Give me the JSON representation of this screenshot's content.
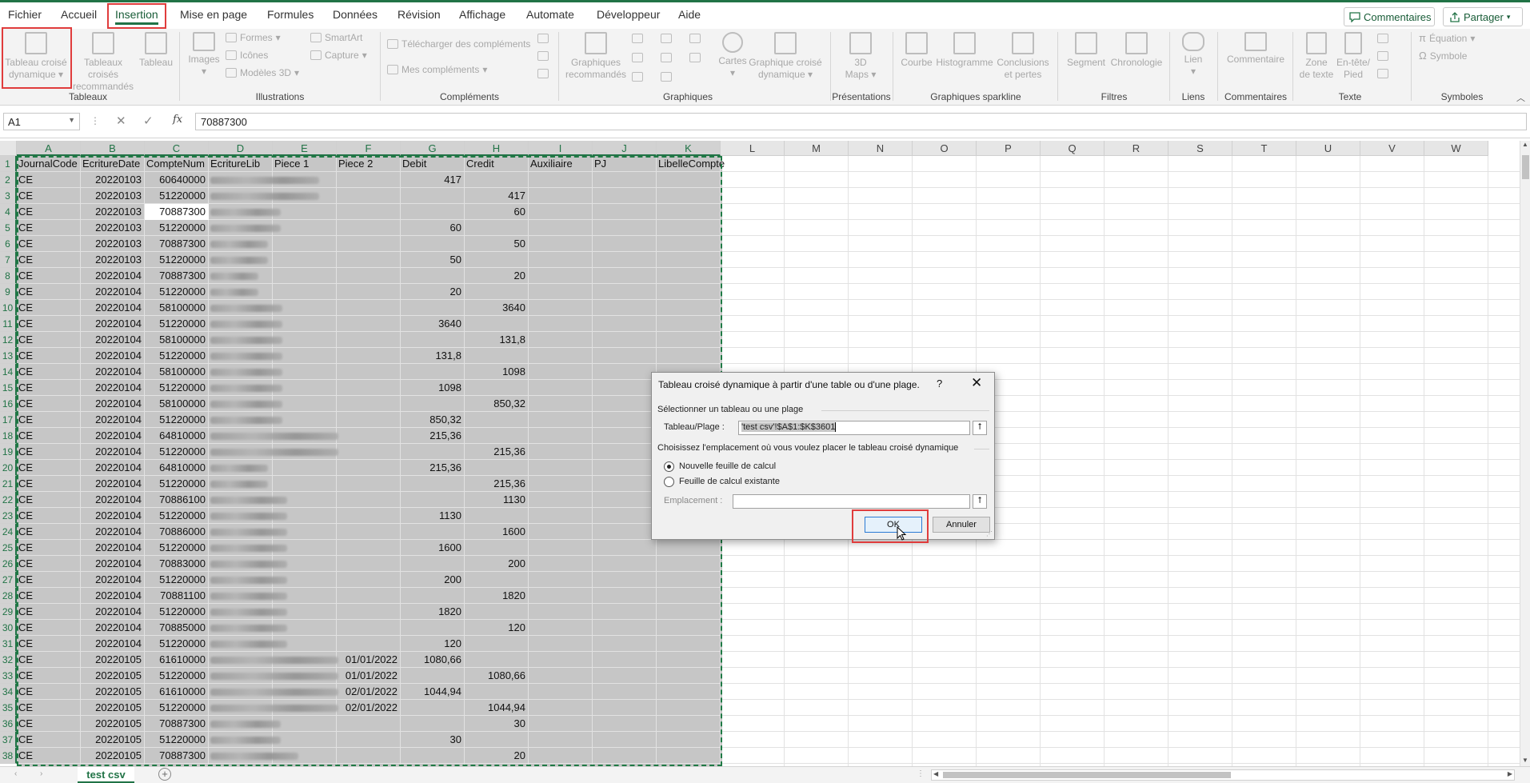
{
  "menu": {
    "tabs": [
      "Fichier",
      "Accueil",
      "Insertion",
      "Mise en page",
      "Formules",
      "Données",
      "Révision",
      "Affichage",
      "Automate",
      "Développeur",
      "Aide"
    ],
    "active_tab": "Insertion",
    "comments_label": "Commentaires",
    "share_label": "Partager"
  },
  "ribbon": {
    "tableaux": {
      "group": "Tableaux",
      "pivot": [
        "Tableau croisé",
        "dynamique"
      ],
      "recommended": [
        "Tableaux croisés",
        "recommandés"
      ],
      "table": "Tableau"
    },
    "illustrations": {
      "group": "Illustrations",
      "images": "Images",
      "forms": "Formes",
      "icons": "Icônes",
      "models3d": "Modèles 3D",
      "smartart": "SmartArt",
      "capture": "Capture"
    },
    "complements": {
      "group": "Compléments",
      "download": "Télécharger des compléments",
      "mine": "Mes compléments"
    },
    "graphiques": {
      "group": "Graphiques",
      "recommended": [
        "Graphiques",
        "recommandés"
      ],
      "maps": "Cartes",
      "pivotchart": [
        "Graphique croisé",
        "dynamique"
      ]
    },
    "presentations": {
      "group": "Présentations",
      "maps3d": [
        "3D",
        "Maps"
      ]
    },
    "sparkline": {
      "group": "Graphiques sparkline",
      "line": "Courbe",
      "histogram": "Histogramme",
      "winloss": [
        "Conclusions",
        "et pertes"
      ]
    },
    "filtres": {
      "group": "Filtres",
      "slicer": "Segment",
      "timeline": "Chronologie"
    },
    "liens": {
      "group": "Liens",
      "link": "Lien"
    },
    "commentaires": {
      "group": "Commentaires",
      "comment": "Commentaire"
    },
    "texte": {
      "group": "Texte",
      "textbox": [
        "Zone",
        "de texte"
      ],
      "header": [
        "En-tête/",
        "Pied"
      ]
    },
    "symboles": {
      "group": "Symboles",
      "equation": "Équation",
      "symbol": "Symbole"
    }
  },
  "formula_bar": {
    "name_box": "A1",
    "fx": "fx",
    "content": "70887300"
  },
  "columns": [
    "A",
    "B",
    "C",
    "D",
    "E",
    "F",
    "G",
    "H",
    "I",
    "J",
    "K",
    "L",
    "M",
    "N",
    "O",
    "P",
    "Q",
    "R",
    "S",
    "T",
    "U",
    "V",
    "W"
  ],
  "header_row": [
    "JournalCode",
    "EcritureDate",
    "CompteNum",
    "EcritureLib",
    "Piece 1",
    "Piece 2",
    "Debit",
    "Credit",
    "Auxiliaire",
    "PJ",
    "LibelleCompte"
  ],
  "rows": [
    {
      "n": "2",
      "a": "CE",
      "b": "20220103",
      "c": "60640000",
      "f": "",
      "g": "417",
      "h": ""
    },
    {
      "n": "3",
      "a": "CE",
      "b": "20220103",
      "c": "51220000",
      "f": "",
      "g": "",
      "h": "417"
    },
    {
      "n": "4",
      "a": "CE",
      "b": "20220103",
      "c": "70887300",
      "f": "",
      "g": "",
      "h": "60"
    },
    {
      "n": "5",
      "a": "CE",
      "b": "20220103",
      "c": "51220000",
      "f": "",
      "g": "60",
      "h": ""
    },
    {
      "n": "6",
      "a": "CE",
      "b": "20220103",
      "c": "70887300",
      "f": "",
      "g": "",
      "h": "50"
    },
    {
      "n": "7",
      "a": "CE",
      "b": "20220103",
      "c": "51220000",
      "f": "",
      "g": "50",
      "h": ""
    },
    {
      "n": "8",
      "a": "CE",
      "b": "20220104",
      "c": "70887300",
      "f": "",
      "g": "",
      "h": "20"
    },
    {
      "n": "9",
      "a": "CE",
      "b": "20220104",
      "c": "51220000",
      "f": "",
      "g": "20",
      "h": ""
    },
    {
      "n": "10",
      "a": "CE",
      "b": "20220104",
      "c": "58100000",
      "f": "",
      "g": "",
      "h": "3640"
    },
    {
      "n": "11",
      "a": "CE",
      "b": "20220104",
      "c": "51220000",
      "f": "",
      "g": "3640",
      "h": ""
    },
    {
      "n": "12",
      "a": "CE",
      "b": "20220104",
      "c": "58100000",
      "f": "",
      "g": "",
      "h": "131,8"
    },
    {
      "n": "13",
      "a": "CE",
      "b": "20220104",
      "c": "51220000",
      "f": "",
      "g": "131,8",
      "h": ""
    },
    {
      "n": "14",
      "a": "CE",
      "b": "20220104",
      "c": "58100000",
      "f": "",
      "g": "",
      "h": "1098"
    },
    {
      "n": "15",
      "a": "CE",
      "b": "20220104",
      "c": "51220000",
      "f": "",
      "g": "1098",
      "h": ""
    },
    {
      "n": "16",
      "a": "CE",
      "b": "20220104",
      "c": "58100000",
      "f": "",
      "g": "",
      "h": "850,32"
    },
    {
      "n": "17",
      "a": "CE",
      "b": "20220104",
      "c": "51220000",
      "f": "",
      "g": "850,32",
      "h": ""
    },
    {
      "n": "18",
      "a": "CE",
      "b": "20220104",
      "c": "64810000",
      "f": "",
      "g": "215,36",
      "h": ""
    },
    {
      "n": "19",
      "a": "CE",
      "b": "20220104",
      "c": "51220000",
      "f": "",
      "g": "",
      "h": "215,36"
    },
    {
      "n": "20",
      "a": "CE",
      "b": "20220104",
      "c": "64810000",
      "f": "",
      "g": "215,36",
      "h": ""
    },
    {
      "n": "21",
      "a": "CE",
      "b": "20220104",
      "c": "51220000",
      "f": "",
      "g": "",
      "h": "215,36"
    },
    {
      "n": "22",
      "a": "CE",
      "b": "20220104",
      "c": "70886100",
      "f": "",
      "g": "",
      "h": "1130"
    },
    {
      "n": "23",
      "a": "CE",
      "b": "20220104",
      "c": "51220000",
      "f": "",
      "g": "1130",
      "h": ""
    },
    {
      "n": "24",
      "a": "CE",
      "b": "20220104",
      "c": "70886000",
      "f": "",
      "g": "",
      "h": "1600"
    },
    {
      "n": "25",
      "a": "CE",
      "b": "20220104",
      "c": "51220000",
      "f": "",
      "g": "1600",
      "h": ""
    },
    {
      "n": "26",
      "a": "CE",
      "b": "20220104",
      "c": "70883000",
      "f": "",
      "g": "",
      "h": "200"
    },
    {
      "n": "27",
      "a": "CE",
      "b": "20220104",
      "c": "51220000",
      "f": "",
      "g": "200",
      "h": ""
    },
    {
      "n": "28",
      "a": "CE",
      "b": "20220104",
      "c": "70881100",
      "f": "",
      "g": "",
      "h": "1820"
    },
    {
      "n": "29",
      "a": "CE",
      "b": "20220104",
      "c": "51220000",
      "f": "",
      "g": "1820",
      "h": ""
    },
    {
      "n": "30",
      "a": "CE",
      "b": "20220104",
      "c": "70885000",
      "f": "",
      "g": "",
      "h": "120"
    },
    {
      "n": "31",
      "a": "CE",
      "b": "20220104",
      "c": "51220000",
      "f": "",
      "g": "120",
      "h": ""
    },
    {
      "n": "32",
      "a": "CE",
      "b": "20220105",
      "c": "61610000",
      "f": "01/01/2022",
      "g": "1080,66",
      "h": ""
    },
    {
      "n": "33",
      "a": "CE",
      "b": "20220105",
      "c": "51220000",
      "f": "01/01/2022",
      "g": "",
      "h": "1080,66"
    },
    {
      "n": "34",
      "a": "CE",
      "b": "20220105",
      "c": "61610000",
      "f": "02/01/2022",
      "g": "1044,94",
      "h": ""
    },
    {
      "n": "35",
      "a": "CE",
      "b": "20220105",
      "c": "51220000",
      "f": "02/01/2022",
      "g": "",
      "h": "1044,94"
    },
    {
      "n": "36",
      "a": "CE",
      "b": "20220105",
      "c": "70887300",
      "f": "",
      "g": "",
      "h": "30"
    },
    {
      "n": "37",
      "a": "CE",
      "b": "20220105",
      "c": "51220000",
      "f": "",
      "g": "30",
      "h": ""
    },
    {
      "n": "38",
      "a": "CE",
      "b": "20220105",
      "c": "70887300",
      "f": "",
      "g": "",
      "h": "20"
    }
  ],
  "dialog": {
    "title": "Tableau croisé dynamique à partir d'une table ou d'une plage.",
    "help": "?",
    "close": "✕",
    "section1": "Sélectionner un tableau ou une plage",
    "range_label": "Tableau/Plage :",
    "range_value": "'test csv'!$A$1:$K$3601",
    "section2": "Choisissez l'emplacement où vous voulez placer le tableau croisé dynamique",
    "option_new": "Nouvelle feuille de calcul",
    "option_existing": "Feuille de calcul existante",
    "location_label": "Emplacement :",
    "location_value": "",
    "ok": "OK",
    "cancel": "Annuler"
  },
  "status": {
    "sheet_tab": "test csv"
  },
  "colors": {
    "excel_green": "#217346",
    "highlight_red": "#e03c3c",
    "selection_gray": "#c6c6c6"
  }
}
